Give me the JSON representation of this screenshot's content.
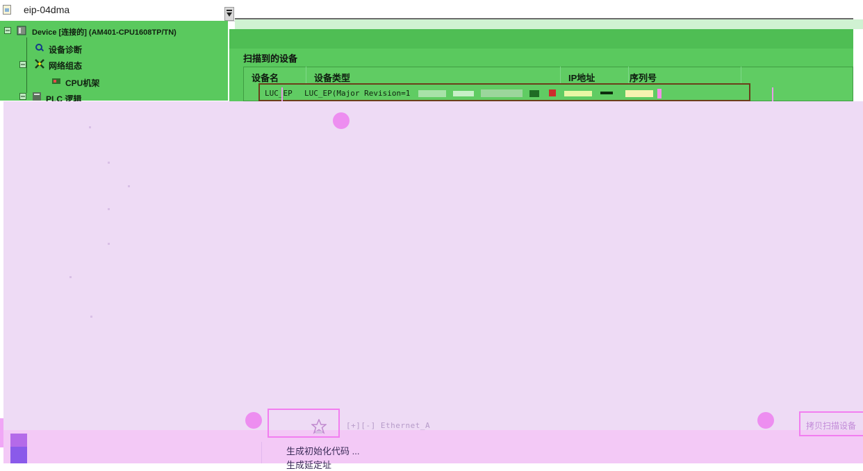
{
  "project": {
    "name": "eip-04dma",
    "icon": "file-icon"
  },
  "tree": {
    "items": [
      {
        "label": "Device [连接的] (AM401-CPU1608TP/TN)",
        "icon": "device-icon"
      },
      {
        "label": "设备诊断",
        "icon": "diagnosis-icon"
      },
      {
        "label": "网络组态",
        "icon": "network-config-icon"
      },
      {
        "label": "CPU机架",
        "icon": "cpu-rack-icon"
      },
      {
        "label": "PLC 逻辑",
        "icon": "plc-logic-icon"
      }
    ]
  },
  "scan": {
    "title": "扫描到的设备",
    "columns": [
      "设备名",
      "设备类型",
      "IP地址",
      "序列号"
    ],
    "rows": [
      {
        "name": "LUC_EP",
        "type": "LUC_EP(Major Revision=1"
      }
    ]
  },
  "bottom": {
    "ethernet_label": "[+][-]  Ethernet_A",
    "copy_button": "拷贝扫描设备",
    "menu": [
      "生成初始化代码 ...",
      "生成延定址"
    ]
  },
  "colors": {
    "green": "#5ac95e",
    "overlay": "#eedbf5",
    "marker": "#ed8ef0"
  }
}
